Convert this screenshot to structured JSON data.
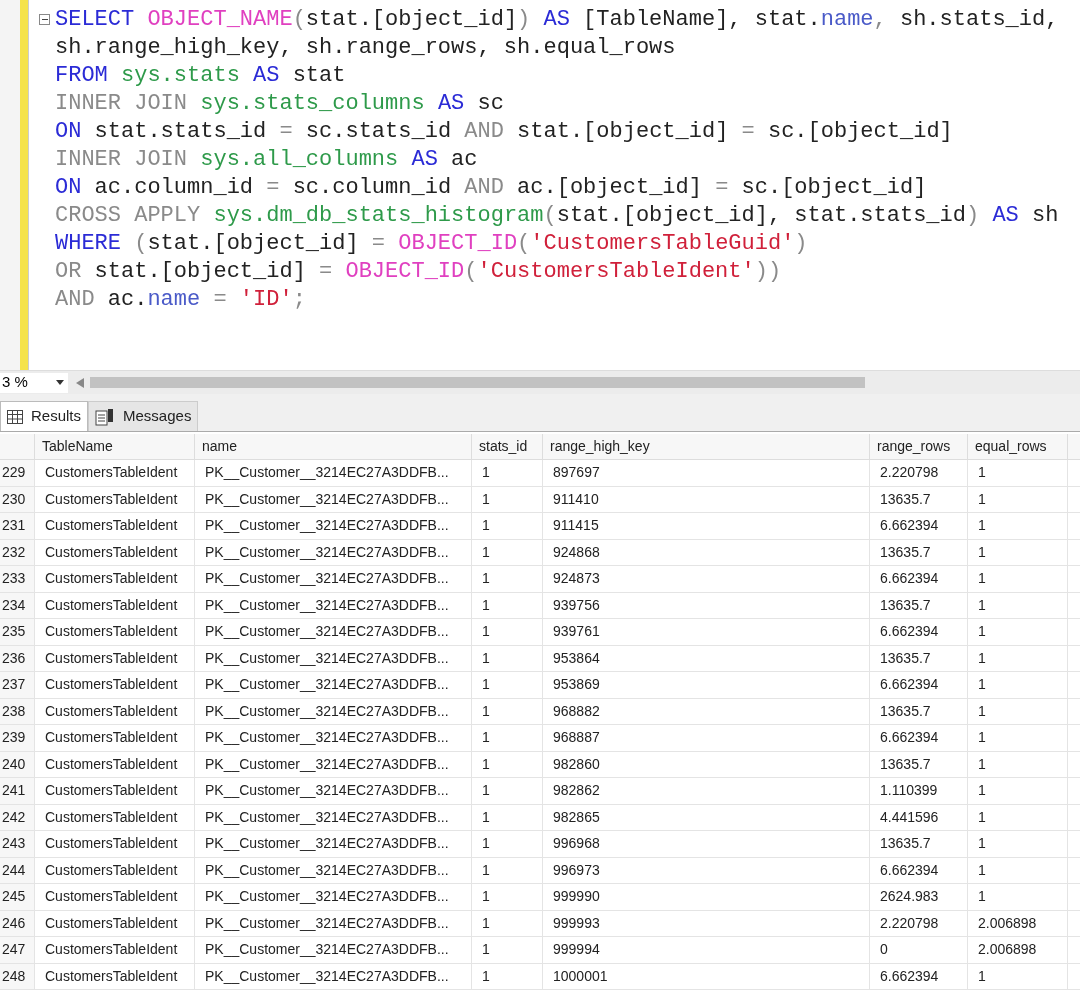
{
  "editor": {
    "lines": [
      [
        {
          "kind": "keyword",
          "text": "SELECT "
        },
        {
          "kind": "function",
          "text": "OBJECT_NAME"
        },
        {
          "kind": "op",
          "text": "("
        },
        {
          "kind": "text",
          "text": "stat.[object_id]"
        },
        {
          "kind": "op",
          "text": ") "
        },
        {
          "kind": "keyword",
          "text": "AS"
        },
        {
          "kind": "text",
          "text": " [TableName], stat."
        },
        {
          "kind": "column",
          "text": "name"
        },
        {
          "kind": "op",
          "text": ","
        },
        {
          "kind": "text",
          "text": " sh.stats_id,"
        }
      ],
      [
        {
          "kind": "text",
          "text": "sh.range_high_key, sh.range_rows, sh.equal_rows"
        }
      ],
      [
        {
          "kind": "keyword",
          "text": "FROM "
        },
        {
          "kind": "system",
          "text": "sys.stats "
        },
        {
          "kind": "keyword",
          "text": "AS"
        },
        {
          "kind": "text",
          "text": " stat"
        }
      ],
      [
        {
          "kind": "op",
          "text": "INNER JOIN "
        },
        {
          "kind": "system",
          "text": "sys.stats_columns "
        },
        {
          "kind": "keyword",
          "text": "AS"
        },
        {
          "kind": "text",
          "text": " sc"
        }
      ],
      [
        {
          "kind": "keyword",
          "text": "ON"
        },
        {
          "kind": "text",
          "text": " stat.stats_id "
        },
        {
          "kind": "op",
          "text": "="
        },
        {
          "kind": "text",
          "text": " sc.stats_id "
        },
        {
          "kind": "op",
          "text": "AND"
        },
        {
          "kind": "text",
          "text": " stat.[object_id] "
        },
        {
          "kind": "op",
          "text": "="
        },
        {
          "kind": "text",
          "text": " sc.[object_id]"
        }
      ],
      [
        {
          "kind": "op",
          "text": "INNER JOIN "
        },
        {
          "kind": "system",
          "text": "sys.all_columns "
        },
        {
          "kind": "keyword",
          "text": "AS"
        },
        {
          "kind": "text",
          "text": " ac"
        }
      ],
      [
        {
          "kind": "keyword",
          "text": "ON"
        },
        {
          "kind": "text",
          "text": " ac.column_id "
        },
        {
          "kind": "op",
          "text": "="
        },
        {
          "kind": "text",
          "text": " sc.column_id "
        },
        {
          "kind": "op",
          "text": "AND"
        },
        {
          "kind": "text",
          "text": " ac.[object_id] "
        },
        {
          "kind": "op",
          "text": "="
        },
        {
          "kind": "text",
          "text": " sc.[object_id]"
        }
      ],
      [
        {
          "kind": "op",
          "text": "CROSS APPLY "
        },
        {
          "kind": "system",
          "text": "sys.dm_db_stats_histogram"
        },
        {
          "kind": "op",
          "text": "("
        },
        {
          "kind": "text",
          "text": "stat.[object_id], stat.stats_id"
        },
        {
          "kind": "op",
          "text": ") "
        },
        {
          "kind": "keyword",
          "text": "AS"
        },
        {
          "kind": "text",
          "text": " sh"
        }
      ],
      [
        {
          "kind": "keyword",
          "text": "WHERE "
        },
        {
          "kind": "op",
          "text": "("
        },
        {
          "kind": "text",
          "text": "stat.[object_id] "
        },
        {
          "kind": "op",
          "text": "= "
        },
        {
          "kind": "function",
          "text": "OBJECT_ID"
        },
        {
          "kind": "op",
          "text": "("
        },
        {
          "kind": "string",
          "text": "'CustomersTableGuid'"
        },
        {
          "kind": "op",
          "text": ")"
        }
      ],
      [
        {
          "kind": "op",
          "text": "OR"
        },
        {
          "kind": "text",
          "text": " stat.[object_id] "
        },
        {
          "kind": "op",
          "text": "= "
        },
        {
          "kind": "function",
          "text": "OBJECT_ID"
        },
        {
          "kind": "op",
          "text": "("
        },
        {
          "kind": "string",
          "text": "'CustomersTableIdent'"
        },
        {
          "kind": "op",
          "text": "))"
        }
      ],
      [
        {
          "kind": "op",
          "text": "AND"
        },
        {
          "kind": "text",
          "text": " ac."
        },
        {
          "kind": "column",
          "text": "name"
        },
        {
          "kind": "op",
          "text": " = "
        },
        {
          "kind": "string",
          "text": "'ID'"
        },
        {
          "kind": "op",
          "text": ";"
        }
      ]
    ]
  },
  "zoom": "3 %",
  "tabs": [
    {
      "label": "Results",
      "selected": true
    },
    {
      "label": "Messages",
      "selected": false
    }
  ],
  "grid": {
    "columns": [
      "",
      "TableName",
      "name",
      "stats_id",
      "range_high_key",
      "range_rows",
      "equal_rows"
    ],
    "rows": [
      [
        "229",
        "CustomersTableIdent",
        "PK__Customer__3214EC27A3DDFB...",
        "1",
        "897697",
        "2.220798",
        "1"
      ],
      [
        "230",
        "CustomersTableIdent",
        "PK__Customer__3214EC27A3DDFB...",
        "1",
        "911410",
        "13635.7",
        "1"
      ],
      [
        "231",
        "CustomersTableIdent",
        "PK__Customer__3214EC27A3DDFB...",
        "1",
        "911415",
        "6.662394",
        "1"
      ],
      [
        "232",
        "CustomersTableIdent",
        "PK__Customer__3214EC27A3DDFB...",
        "1",
        "924868",
        "13635.7",
        "1"
      ],
      [
        "233",
        "CustomersTableIdent",
        "PK__Customer__3214EC27A3DDFB...",
        "1",
        "924873",
        "6.662394",
        "1"
      ],
      [
        "234",
        "CustomersTableIdent",
        "PK__Customer__3214EC27A3DDFB...",
        "1",
        "939756",
        "13635.7",
        "1"
      ],
      [
        "235",
        "CustomersTableIdent",
        "PK__Customer__3214EC27A3DDFB...",
        "1",
        "939761",
        "6.662394",
        "1"
      ],
      [
        "236",
        "CustomersTableIdent",
        "PK__Customer__3214EC27A3DDFB...",
        "1",
        "953864",
        "13635.7",
        "1"
      ],
      [
        "237",
        "CustomersTableIdent",
        "PK__Customer__3214EC27A3DDFB...",
        "1",
        "953869",
        "6.662394",
        "1"
      ],
      [
        "238",
        "CustomersTableIdent",
        "PK__Customer__3214EC27A3DDFB...",
        "1",
        "968882",
        "13635.7",
        "1"
      ],
      [
        "239",
        "CustomersTableIdent",
        "PK__Customer__3214EC27A3DDFB...",
        "1",
        "968887",
        "6.662394",
        "1"
      ],
      [
        "240",
        "CustomersTableIdent",
        "PK__Customer__3214EC27A3DDFB...",
        "1",
        "982860",
        "13635.7",
        "1"
      ],
      [
        "241",
        "CustomersTableIdent",
        "PK__Customer__3214EC27A3DDFB...",
        "1",
        "982862",
        "1.110399",
        "1"
      ],
      [
        "242",
        "CustomersTableIdent",
        "PK__Customer__3214EC27A3DDFB...",
        "1",
        "982865",
        "4.441596",
        "1"
      ],
      [
        "243",
        "CustomersTableIdent",
        "PK__Customer__3214EC27A3DDFB...",
        "1",
        "996968",
        "13635.7",
        "1"
      ],
      [
        "244",
        "CustomersTableIdent",
        "PK__Customer__3214EC27A3DDFB...",
        "1",
        "996973",
        "6.662394",
        "1"
      ],
      [
        "245",
        "CustomersTableIdent",
        "PK__Customer__3214EC27A3DDFB...",
        "1",
        "999990",
        "2624.983",
        "1"
      ],
      [
        "246",
        "CustomersTableIdent",
        "PK__Customer__3214EC27A3DDFB...",
        "1",
        "999993",
        "2.220798",
        "2.006898"
      ],
      [
        "247",
        "CustomersTableIdent",
        "PK__Customer__3214EC27A3DDFB...",
        "1",
        "999994",
        "0",
        "2.006898"
      ],
      [
        "248",
        "CustomersTableIdent",
        "PK__Customer__3214EC27A3DDFB...",
        "1",
        "1000001",
        "6.662394",
        "1"
      ]
    ]
  }
}
